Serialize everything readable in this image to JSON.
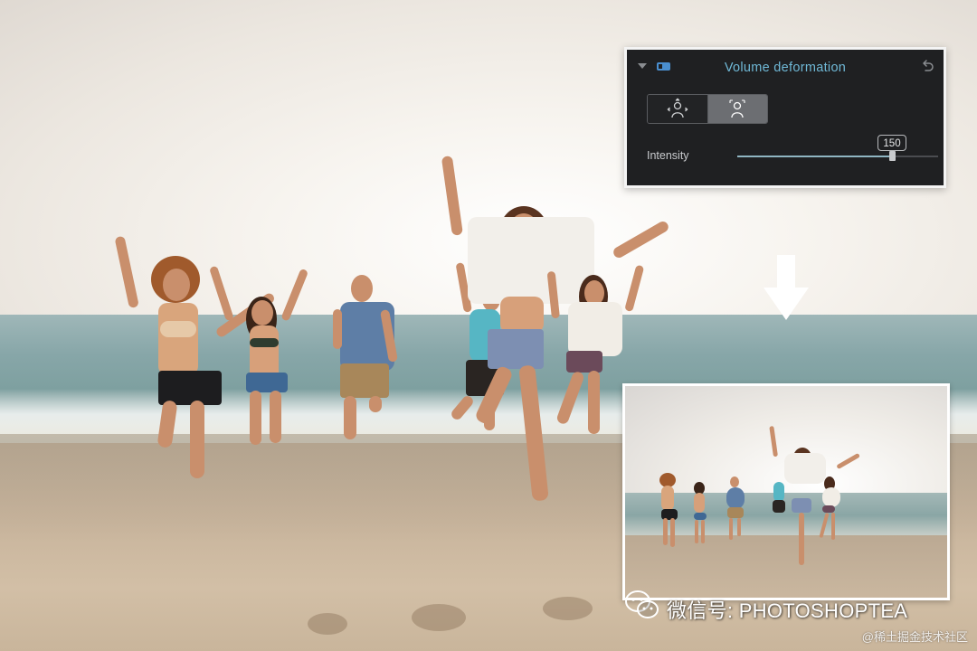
{
  "panel": {
    "title": "Volume deformation",
    "mode_buttons": [
      {
        "icon": "volume-expand-icon",
        "selected": false
      },
      {
        "icon": "volume-shrink-icon",
        "selected": true
      }
    ],
    "intensity_label": "Intensity",
    "intensity_value": "150",
    "intensity_fraction": 0.77,
    "accent_color": "#6fb8d6"
  },
  "watermark": {
    "text": "微信号: PHOTOSHOPTEA",
    "secondary": "@稀土掘金技术社区"
  }
}
